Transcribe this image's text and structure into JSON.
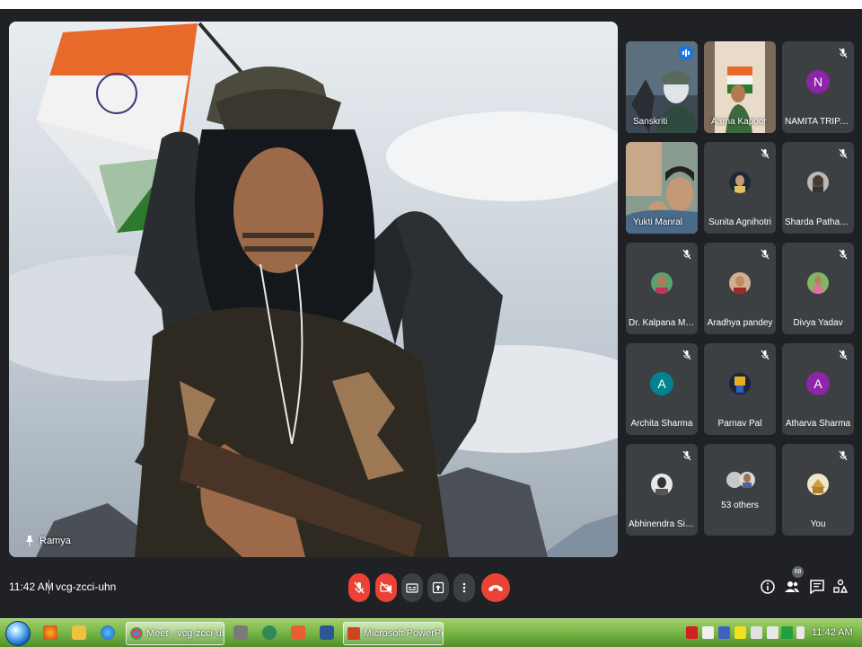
{
  "main_video": {
    "name": "Ramya"
  },
  "participants": [
    {
      "name": "Sanskriti"
    },
    {
      "name": "Aarna Kapoor"
    },
    {
      "name": "NAMITA TRIPATHI",
      "initial": "N",
      "color": "#8e24aa"
    },
    {
      "name": "Yukti Manral"
    },
    {
      "name": "Sunita Agnihotri"
    },
    {
      "name": "Sharda Pathania"
    },
    {
      "name": "Dr. Kalpana Mah..."
    },
    {
      "name": "Aradhya pandey"
    },
    {
      "name": "Divya Yadav"
    },
    {
      "name": "Archita Sharma",
      "initial": "A",
      "color": "#00838f"
    },
    {
      "name": "Parnav Pal"
    },
    {
      "name": "Atharva Sharma",
      "initial": "A",
      "color": "#8e24aa"
    },
    {
      "name": "Abhinendra Sin..."
    },
    {
      "name": "53 others"
    },
    {
      "name": "You"
    }
  ],
  "meeting": {
    "time": "11:42 AM",
    "code": "vcg-zcci-uhn",
    "people_count": "68"
  },
  "controls": {
    "mic_icon": "mic-off-icon",
    "camera_icon": "camera-off-icon",
    "captions_icon": "captions-icon",
    "present_icon": "present-icon",
    "more_icon": "more-options-icon",
    "end_icon": "end-call-icon",
    "end_color": "#ea4335",
    "muted_color": "#ea4335"
  },
  "taskbar": {
    "tasks": [
      {
        "label": "Meet - vcg-zcci-uhn ..."
      },
      {
        "label": "Microsoft PowerPoin..."
      }
    ],
    "clock": "11:42 AM"
  }
}
